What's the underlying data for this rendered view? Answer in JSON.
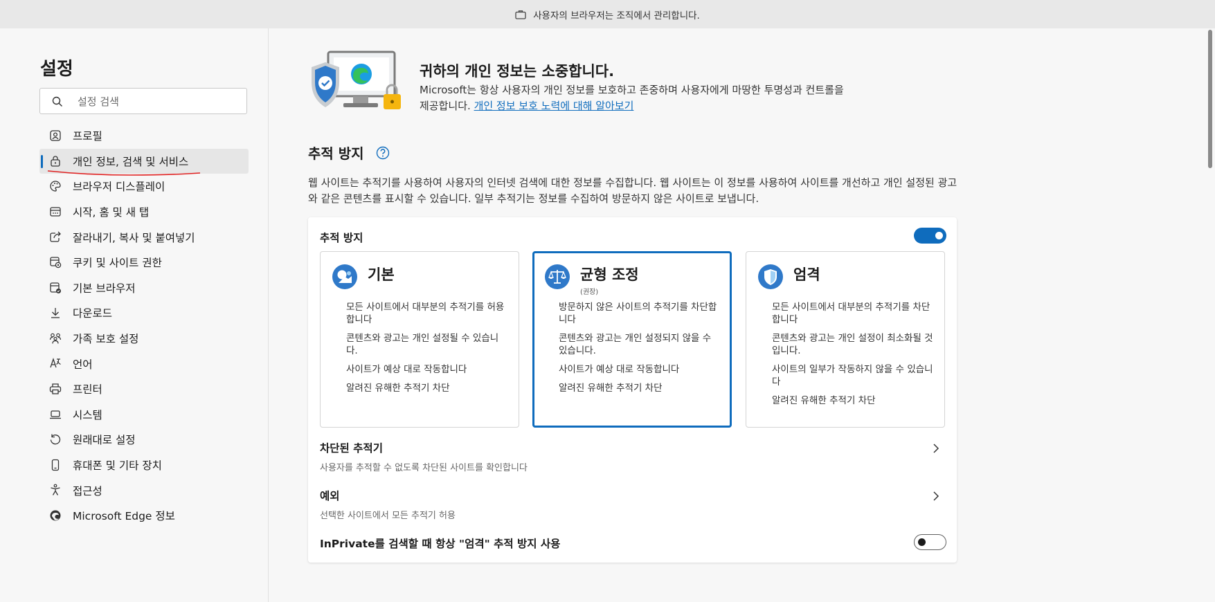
{
  "managed_bar": {
    "text": "사용자의 브라우저는 조직에서 관리합니다."
  },
  "sidebar": {
    "title": "설정",
    "search_placeholder": "설정 검색",
    "items": [
      {
        "label": "프로필",
        "icon": "profile-icon"
      },
      {
        "label": "개인 정보, 검색 및 서비스",
        "icon": "privacy-lock-icon",
        "active": true
      },
      {
        "label": "브라우저 디스플레이",
        "icon": "palette-icon"
      },
      {
        "label": "시작, 홈 및 새 탭",
        "icon": "home-tab-icon"
      },
      {
        "label": "잘라내기, 복사 및 붙여넣기",
        "icon": "share-icon"
      },
      {
        "label": "쿠키 및 사이트 권한",
        "icon": "cookie-permissions-icon"
      },
      {
        "label": "기본 브라우저",
        "icon": "default-browser-icon"
      },
      {
        "label": "다운로드",
        "icon": "download-icon"
      },
      {
        "label": "가족 보호 설정",
        "icon": "family-icon"
      },
      {
        "label": "언어",
        "icon": "language-icon"
      },
      {
        "label": "프린터",
        "icon": "printer-icon"
      },
      {
        "label": "시스템",
        "icon": "laptop-icon"
      },
      {
        "label": "원래대로 설정",
        "icon": "reset-icon"
      },
      {
        "label": "휴대폰 및 기타 장치",
        "icon": "phone-icon"
      },
      {
        "label": "접근성",
        "icon": "accessibility-icon"
      },
      {
        "label": "Microsoft Edge 정보",
        "icon": "edge-logo-icon"
      }
    ]
  },
  "hero": {
    "title": "귀하의 개인 정보는 소중합니다.",
    "desc": "Microsoft는 항상 사용자의 개인 정보를 보호하고 존중하며 사용자에게 마땅한 투명성과 컨트롤을 제공합니다.",
    "link": "개인 정보 보호 노력에 대해 알아보기"
  },
  "tracking": {
    "section_title": "추적 방지",
    "section_desc": "웹 사이트는 추적기를 사용하여 사용자의 인터넷 검색에 대한 정보를 수집합니다. 웹 사이트는 이 정보를 사용하여 사이트를 개선하고 개인 설정된 광고와 같은 콘텐츠를 표시할 수 있습니다. 일부 추적기는 정보를 수집하여 방문하지 않은 사이트로 보냅니다.",
    "card_title": "추적 방지",
    "enabled": true,
    "options": [
      {
        "title": "기본",
        "subtitle": "",
        "selected": false,
        "bullets": [
          "모든 사이트에서 대부분의 추적기를 허용합니다",
          "콘텐츠와 광고는 개인 설정될 수 있습니다.",
          "사이트가 예상 대로 작동합니다",
          "알려진 유해한 추적기 차단"
        ]
      },
      {
        "title": "균형 조정",
        "subtitle": "(권장)",
        "selected": true,
        "bullets": [
          "방문하지 않은 사이트의 추적기를 차단합니다",
          "콘텐츠와 광고는 개인 설정되지 않을 수 있습니다.",
          "사이트가 예상 대로 작동합니다",
          "알려진 유해한 추적기 차단"
        ]
      },
      {
        "title": "엄격",
        "subtitle": "",
        "selected": false,
        "bullets": [
          "모든 사이트에서 대부분의 추적기를 차단합니다",
          "콘텐츠와 광고는 개인 설정이 최소화될 것입니다.",
          "사이트의 일부가 작동하지 않을 수 있습니다",
          "알려진 유해한 추적기 차단"
        ]
      }
    ],
    "blocked": {
      "title": "차단된 추적기",
      "desc": "사용자를 추적할 수 없도록 차단된 사이트를 확인합니다"
    },
    "exceptions": {
      "title": "예외",
      "desc": "선택한 사이트에서 모든 추적기 허용"
    },
    "inprivate": {
      "label": "InPrivate를 검색할 때 항상 \"엄격\" 추적 방지 사용",
      "enabled": false
    }
  },
  "colors": {
    "accent": "#0f6cbd",
    "annotation": "#e02020"
  }
}
